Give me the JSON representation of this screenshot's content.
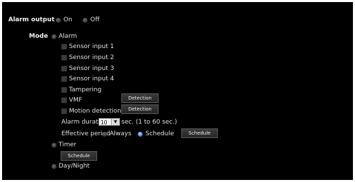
{
  "alarm_output": {
    "label": "Alarm output",
    "on_label": "On",
    "off_label": "Off"
  },
  "mode": {
    "label": "Mode",
    "alarm_label": "Alarm",
    "sensors": [
      "Sensor input 1",
      "Sensor input 2",
      "Sensor input 3",
      "Sensor input 4",
      "Tampering",
      "VMF",
      "Motion detection"
    ],
    "detection_label": "Detection",
    "alarm_duration": {
      "label": "Alarm duration",
      "value": "10",
      "unit_label": "sec. (1 to 60 sec.)"
    },
    "effective_period": {
      "label": "Effective period",
      "always_label": "Always",
      "schedule_label": "Schedule",
      "schedule_button": "Schedule"
    },
    "timer_label": "Timer",
    "timer_schedule_button": "Schedule",
    "daynight_label": "Day/Night"
  },
  "colors": {
    "background": "#000000",
    "selected_radio": "#5b93d6"
  }
}
